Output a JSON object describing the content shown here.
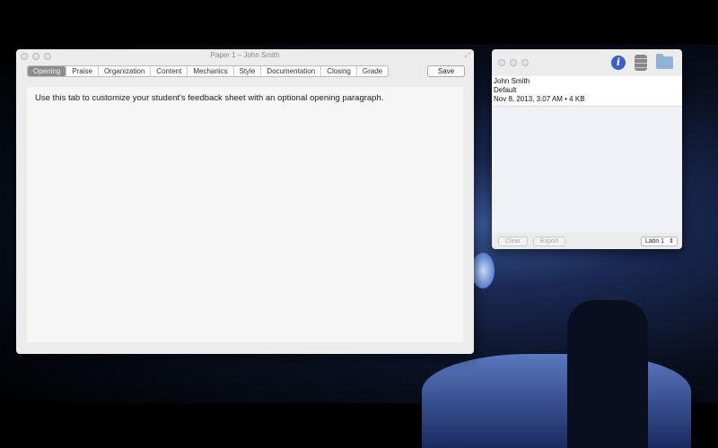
{
  "main_window": {
    "title": "Paper 1 – John Smith",
    "tabs": [
      "Opening",
      "Praise",
      "Organization",
      "Content",
      "Mechanics",
      "Style",
      "Documentation",
      "Closing",
      "Grade"
    ],
    "active_tab": "Opening",
    "save_label": "Save",
    "content_text": "Use this tab to customize your student's feedback sheet with an optional opening paragraph."
  },
  "side_window": {
    "toolbar_icons": [
      "info-icon",
      "database-icon",
      "folder-icon"
    ],
    "info_glyph": "i",
    "name": "John Smith",
    "profile": "Default",
    "details": "Nov 8, 2013, 3:07 AM • 4 KB",
    "clear_label": "Clear",
    "export_label": "Export",
    "encoding": "Latin 1",
    "encoding_arrows": "⇕"
  }
}
